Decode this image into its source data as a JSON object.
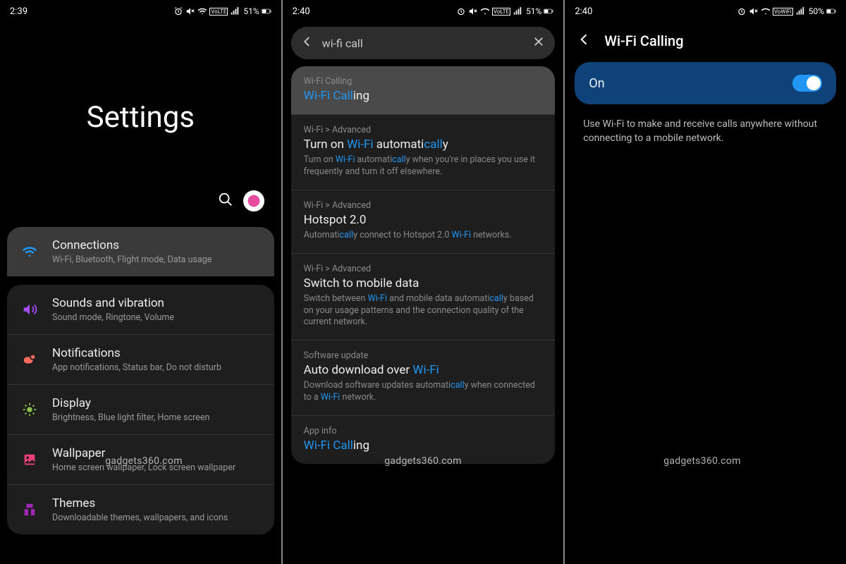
{
  "watermark": "gadgets360.com",
  "status": {
    "time1": "2:39",
    "time2": "2:40",
    "time3": "2:40",
    "batt1": "51%",
    "batt2": "51%",
    "batt3": "50%",
    "net_label": "VoLTE",
    "net_label3": "VoWiFi"
  },
  "panel1": {
    "title": "Settings",
    "items": [
      {
        "title": "Connections",
        "sub": "Wi-Fi, Bluetooth, Flight mode, Data usage"
      },
      {
        "title": "Sounds and vibration",
        "sub": "Sound mode, Ringtone, Volume"
      },
      {
        "title": "Notifications",
        "sub": "App notifications, Status bar, Do not disturb"
      },
      {
        "title": "Display",
        "sub": "Brightness, Blue light filter, Home screen"
      },
      {
        "title": "Wallpaper",
        "sub": "Home screen wallpaper, Lock screen wallpaper"
      },
      {
        "title": "Themes",
        "sub": "Downloadable themes, wallpapers, and icons"
      }
    ]
  },
  "panel2": {
    "query": "wi-fi call",
    "results": [
      {
        "path": "Wi-Fi Calling",
        "title_pre": "Wi-Fi Call",
        "title_post": "ing"
      },
      {
        "path": "Wi-Fi > Advanced",
        "title_a": "Turn on ",
        "title_b": "Wi-Fi",
        "title_c": " automati",
        "title_d": "call",
        "title_e": "y",
        "desc_a": "Turn on ",
        "desc_b": "Wi-Fi",
        "desc_c": " automati",
        "desc_d": "call",
        "desc_e": "y when you're in places you use it frequently and turn it off elsewhere."
      },
      {
        "path": "Wi-Fi > Advanced",
        "title": "Hotspot 2.0",
        "desc_a": "Automati",
        "desc_b": "call",
        "desc_c": "y connect to Hotspot 2.0 ",
        "desc_d": "Wi-Fi",
        "desc_e": " networks."
      },
      {
        "path": "Wi-Fi > Advanced",
        "title": "Switch to mobile data",
        "desc_a": "Switch between ",
        "desc_b": "Wi-Fi",
        "desc_c": " and mobile data automati",
        "desc_d": "call",
        "desc_e": "y based on your usage patterns and the connection quality of the current network."
      },
      {
        "path": "Software update",
        "title_a": "Auto download over ",
        "title_b": "Wi-Fi",
        "desc_a": "Download software updates automati",
        "desc_b": "call",
        "desc_c": "y when connected to a ",
        "desc_d": "Wi-Fi",
        "desc_e": " network."
      },
      {
        "path": "App info",
        "title_pre": "Wi-Fi Call",
        "title_post": "ing"
      }
    ]
  },
  "panel3": {
    "title": "Wi-Fi Calling",
    "toggle_label": "On",
    "toggle_state": true,
    "description": "Use Wi-Fi to make and receive calls anywhere without connecting to a mobile network."
  }
}
